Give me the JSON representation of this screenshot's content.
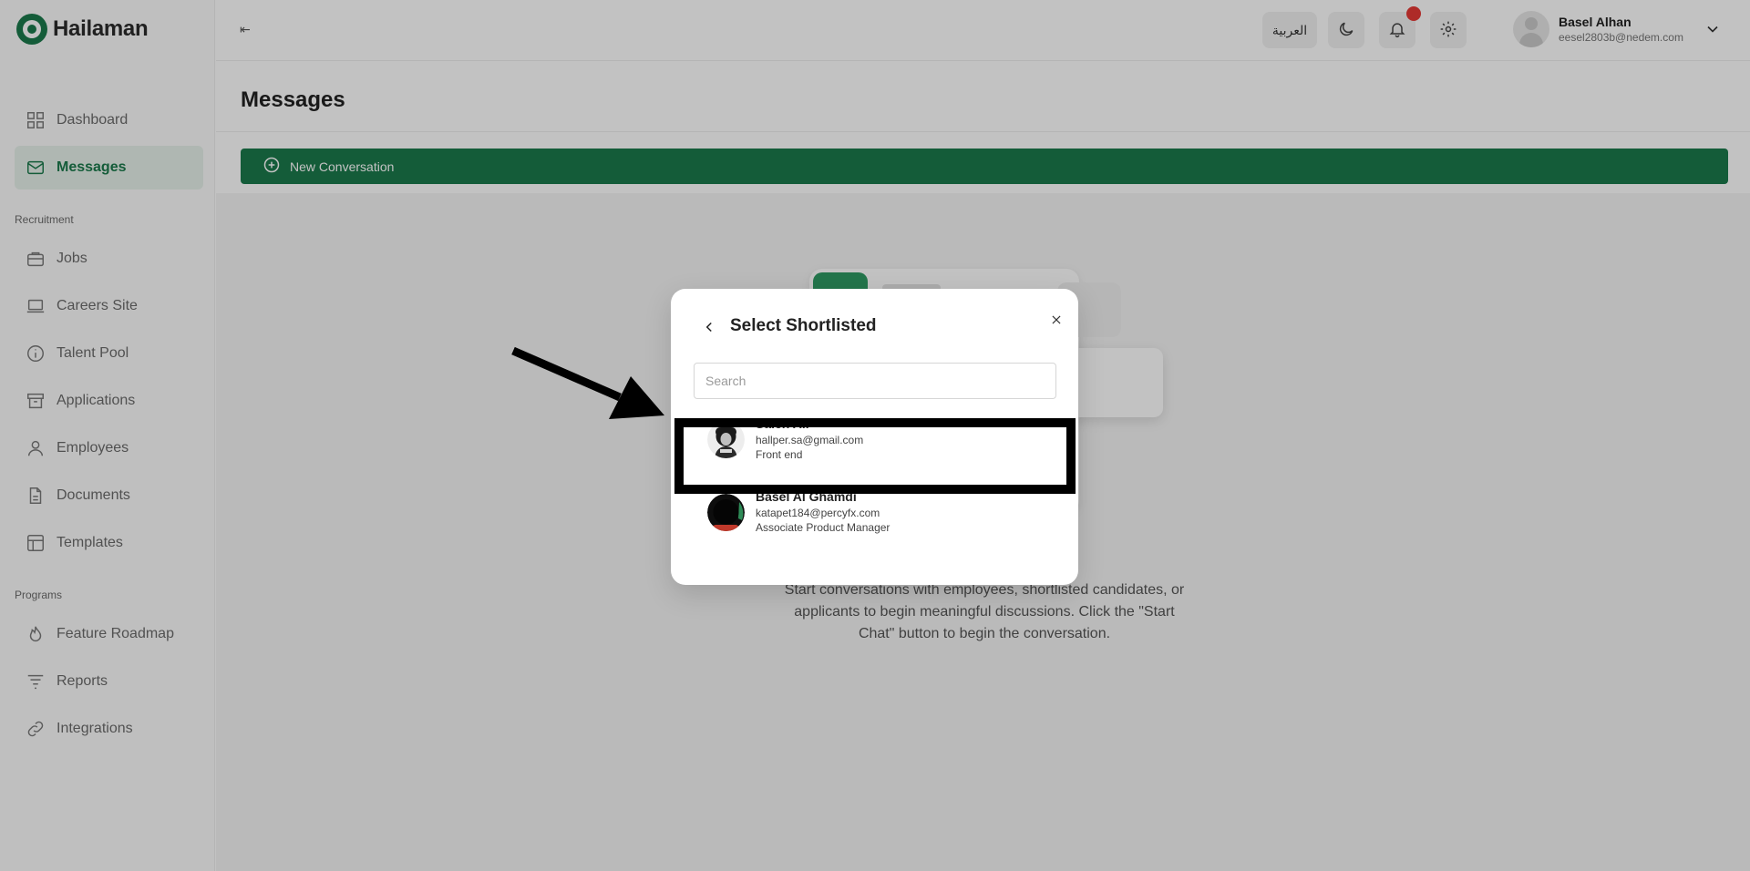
{
  "app": {
    "name": "Hailaman"
  },
  "sidebar": {
    "items": [
      {
        "label": "Dashboard",
        "icon": "dashboard-icon"
      },
      {
        "label": "Messages",
        "icon": "mail-icon",
        "active": true
      }
    ],
    "sections": [
      {
        "label": "Recruitment",
        "items": [
          {
            "label": "Jobs",
            "icon": "briefcase-icon"
          },
          {
            "label": "Careers Site",
            "icon": "laptop-icon"
          },
          {
            "label": "Talent Pool",
            "icon": "info-circle-icon"
          },
          {
            "label": "Applications",
            "icon": "archive-icon"
          },
          {
            "label": "Employees",
            "icon": "user-icon"
          },
          {
            "label": "Documents",
            "icon": "document-icon"
          },
          {
            "label": "Templates",
            "icon": "template-icon"
          }
        ]
      },
      {
        "label": "Programs",
        "items": [
          {
            "label": "Feature Roadmap",
            "icon": "flame-icon"
          },
          {
            "label": "Reports",
            "icon": "filter-icon"
          },
          {
            "label": "Integrations",
            "icon": "link-icon"
          }
        ]
      }
    ]
  },
  "header": {
    "language_label": "العربية",
    "user": {
      "name": "Basel Alhan",
      "email": "eesel2803b@nedem.com"
    },
    "notification_dot_color": "#e53935"
  },
  "main": {
    "title": "Messages",
    "new_conversation_label": "New Conversation",
    "empty_state_text": "Start conversations with employees, shortlisted candidates, or applicants to begin meaningful discussions. Click the \"Start Chat\" button to begin the conversation."
  },
  "modal": {
    "title": "Select Shortlisted",
    "search_placeholder": "Search",
    "search_value": "",
    "candidates": [
      {
        "name": "Saleh Ali",
        "email": "hallper.sa@gmail.com",
        "role": "Front end"
      },
      {
        "name": "Basel Al Ghamdi",
        "email": "katapet184@percyfx.com",
        "role": "Associate Product Manager"
      }
    ]
  },
  "theme": {
    "accent": "#1b7a4c",
    "accent_light": "#e7f1ea"
  }
}
